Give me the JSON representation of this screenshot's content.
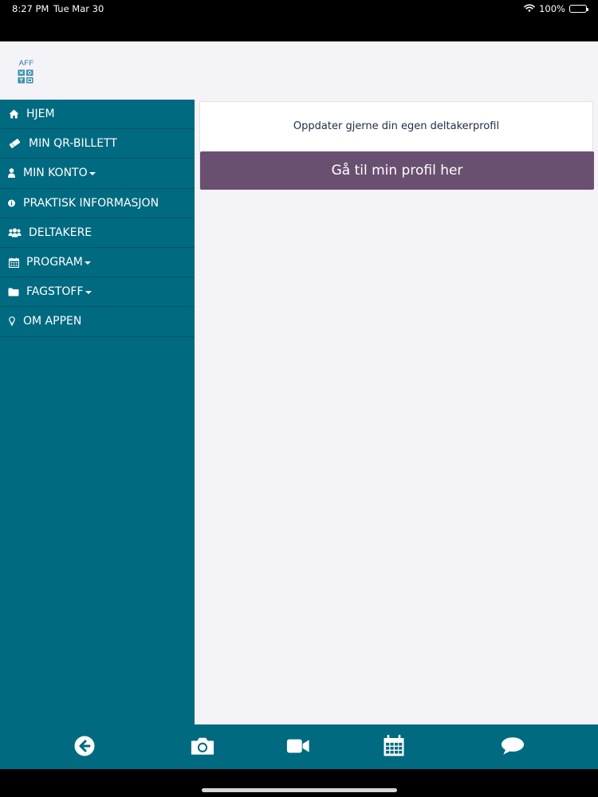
{
  "status_bar": {
    "time": "8:27 PM",
    "date": "Tue Mar 30",
    "battery": "100%",
    "battery_level": 1.0
  },
  "header": {
    "logo_text": "AFF",
    "logo_icon": "aff-logo-grid"
  },
  "sidebar": {
    "items": [
      {
        "label": "HJEM",
        "icon": "home-icon"
      },
      {
        "label": "MIN QR-BILLETT",
        "icon": "ticket-icon"
      },
      {
        "label": "MIN KONTO",
        "icon": "user-icon",
        "dropdown": true
      },
      {
        "label": "PRAKTISK INFORMASJON",
        "icon": "info-icon"
      },
      {
        "label": "DELTAKERE",
        "icon": "users-icon"
      },
      {
        "label": "PROGRAM",
        "icon": "calendar-icon",
        "dropdown": true
      },
      {
        "label": "FAGSTOFF",
        "icon": "folder-icon",
        "dropdown": true
      },
      {
        "label": "OM APPEN",
        "icon": "lightbulb-icon"
      }
    ]
  },
  "main": {
    "card_text": "Oppdater gjerne din egen deltakerprofil",
    "profile_button_label": "Gå til min profil her"
  },
  "bottom_bar": {
    "buttons": [
      "back-arrow-icon",
      "camera-icon",
      "video-camera-icon",
      "calendar-icon",
      "chat-bubble-icon"
    ]
  },
  "colors": {
    "sidebar_bg": "#006a80",
    "content_bg": "#f4f3f7",
    "button_bg": "#6a5070",
    "card_text": "#222d4b"
  }
}
